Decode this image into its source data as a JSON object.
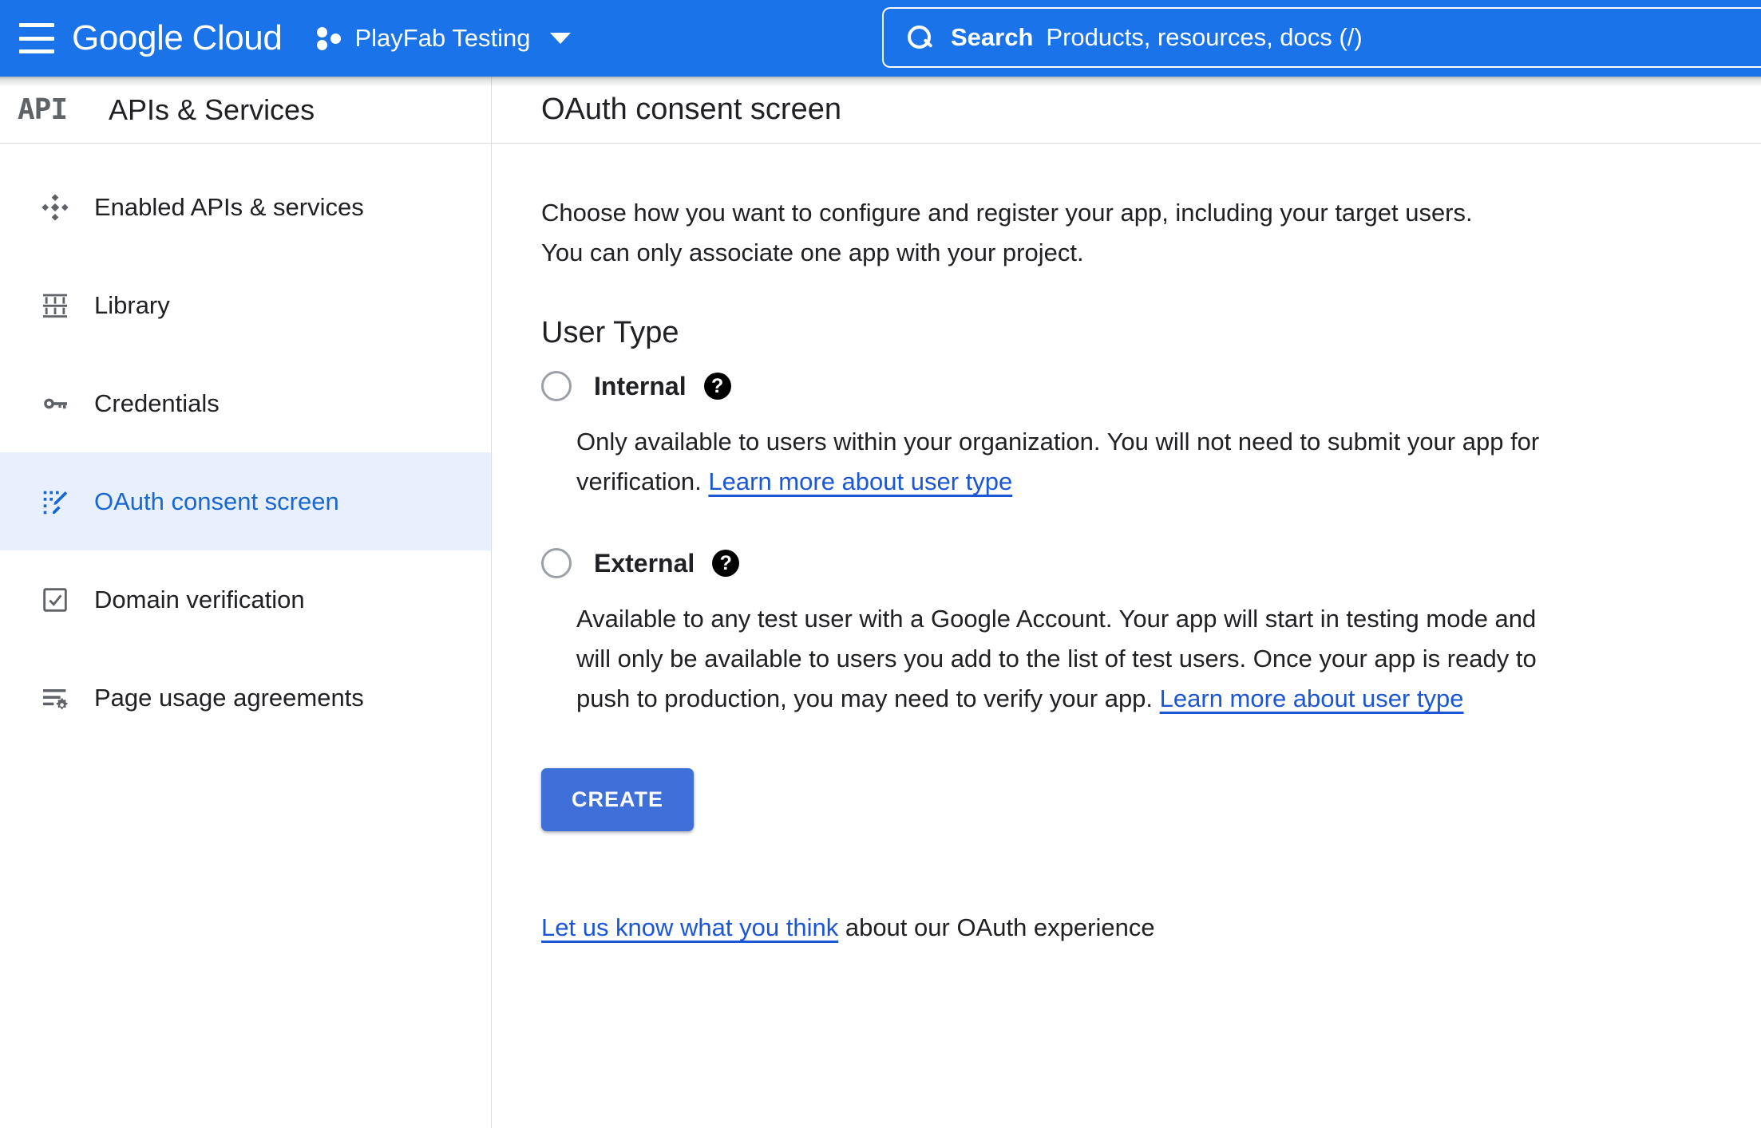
{
  "topbar": {
    "menu_icon": "hamburger-menu-icon",
    "brand_first": "Google",
    "brand_second": "Cloud",
    "project_icon": "project-nodes-icon",
    "project_name": "PlayFab Testing",
    "project_caret": "chevron-down-icon",
    "background_color": "#1a73e8"
  },
  "search": {
    "icon": "search-icon",
    "label": "Search",
    "placeholder": "Products, resources, docs (/)"
  },
  "sidebar": {
    "logo_text": "API",
    "title": "APIs & Services",
    "items": [
      {
        "label": "Enabled APIs & services",
        "icon": "dashboard-diamond-icon",
        "active": false
      },
      {
        "label": "Library",
        "icon": "library-columns-icon",
        "active": false
      },
      {
        "label": "Credentials",
        "icon": "key-icon",
        "active": false
      },
      {
        "label": "OAuth consent screen",
        "icon": "consent-pencil-icon",
        "active": true
      },
      {
        "label": "Domain verification",
        "icon": "checkbox-check-icon",
        "active": false
      },
      {
        "label": "Page usage agreements",
        "icon": "list-gear-icon",
        "active": false
      }
    ],
    "active_background": "#e8f0fe",
    "active_text_color": "#1967d2"
  },
  "main": {
    "page_title": "OAuth consent screen",
    "intro": "Choose how you want to configure and register your app, including your target users. You can only associate one app with your project.",
    "section_title": "User Type",
    "options": [
      {
        "label": "Internal",
        "help_icon": "help-circle-icon",
        "selected": false,
        "description_text": "Only available to users within your organization. You will not need to submit your app for verification. ",
        "description_link": "Learn more about user type"
      },
      {
        "label": "External",
        "help_icon": "help-circle-icon",
        "selected": false,
        "description_text": "Available to any test user with a Google Account. Your app will start in testing mode and will only be available to users you add to the list of test users. Once your app is ready to push to production, you may need to verify your app. ",
        "description_link": "Learn more about user type"
      }
    ],
    "create_button": "CREATE",
    "create_button_color": "#3f6fd8",
    "footer_link": "Let us know what you think",
    "footer_text": " about our OAuth experience",
    "link_color": "#1a56d6"
  }
}
